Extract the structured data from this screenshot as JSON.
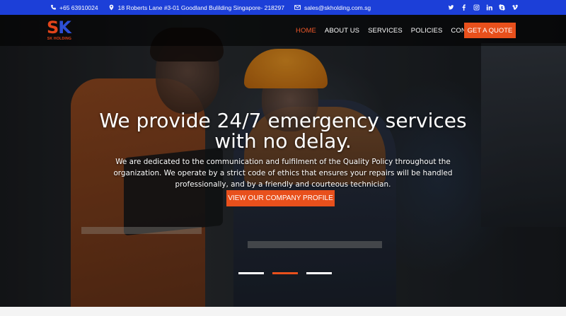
{
  "topbar": {
    "phone": "+65 63910024",
    "address": "18 Roberts Lane #3-01 Goodland Bulilding Singapore- 218297",
    "email": "sales@skholding.com.sg",
    "social_icons": [
      "twitter-icon",
      "facebook-icon",
      "instagram-icon",
      "linkedin-icon",
      "skype-icon",
      "vimeo-icon"
    ]
  },
  "brand": {
    "logo_letters_1": "S",
    "logo_letters_2": "K",
    "logo_text": "SK HOLDING",
    "accent": "#e8501c",
    "blue": "#1c3fd8"
  },
  "nav": {
    "items": [
      "HOME",
      "ABOUT US",
      "SERVICES",
      "POLICIES",
      "CONTACT"
    ],
    "active": "HOME",
    "cta": "GET A QUOTE"
  },
  "hero": {
    "headline_line1": "We provide 24/7 emergency services",
    "headline_line2": "with no delay.",
    "sub_line1": "We are dedicated to the communication and fulfilment of the Quality Policy throughout the",
    "sub_line2": "organization. We operate by a strict code of ethics that ensures your repairs will be handled",
    "sub_line3": "professionally, and by a friendly and courteous technician.",
    "button": "VIEW OUR COMPANY PROFILE",
    "slides": 3,
    "active_slide": 2
  }
}
